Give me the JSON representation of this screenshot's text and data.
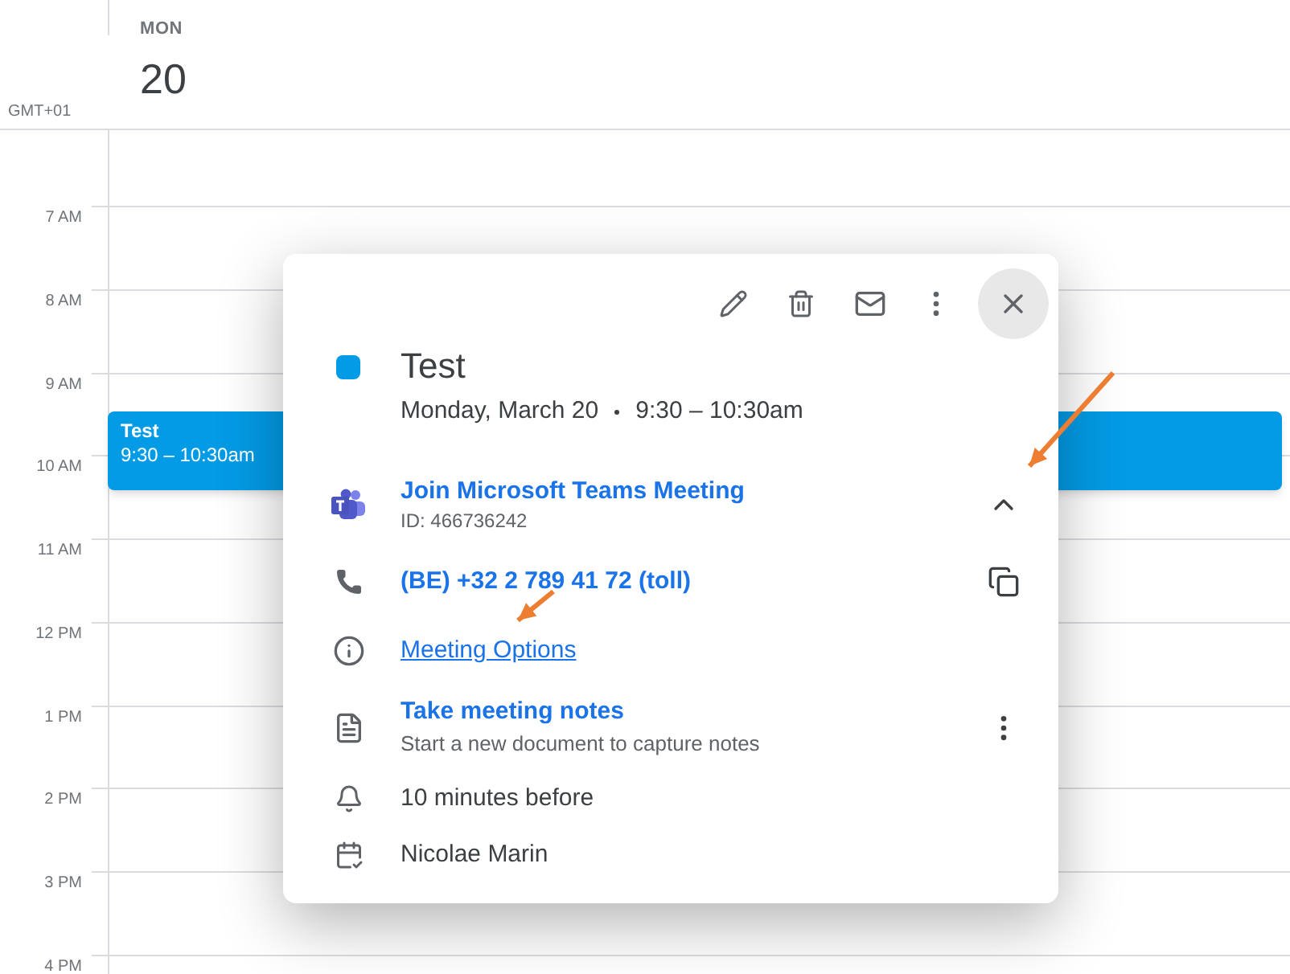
{
  "day": {
    "weekday": "MON",
    "date": "20",
    "timezone": "GMT+01"
  },
  "hours": [
    "7 AM",
    "8 AM",
    "9 AM",
    "10 AM",
    "11 AM",
    "12 PM",
    "1 PM",
    "2 PM",
    "3 PM",
    "4 PM"
  ],
  "event": {
    "title": "Test",
    "time": "9:30 – 10:30am",
    "color": "#039be5"
  },
  "popup": {
    "title": "Test",
    "date": "Monday, March 20",
    "time": "9:30 – 10:30am",
    "color": "#039be5",
    "rows": [
      {
        "kind": "teams",
        "title": "Join Microsoft Teams Meeting",
        "subtitle": "ID: 466736242",
        "expanded": true
      },
      {
        "kind": "phone",
        "title": "(BE) +32 2 789 41 72 (toll)"
      },
      {
        "kind": "info",
        "link": "Meeting Options"
      },
      {
        "kind": "notes",
        "title": "Take meeting notes",
        "subtitle": "Start a new document to capture notes"
      },
      {
        "kind": "reminder",
        "text": "10 minutes before"
      },
      {
        "kind": "calendar",
        "text": "Nicolae Marin"
      }
    ]
  }
}
